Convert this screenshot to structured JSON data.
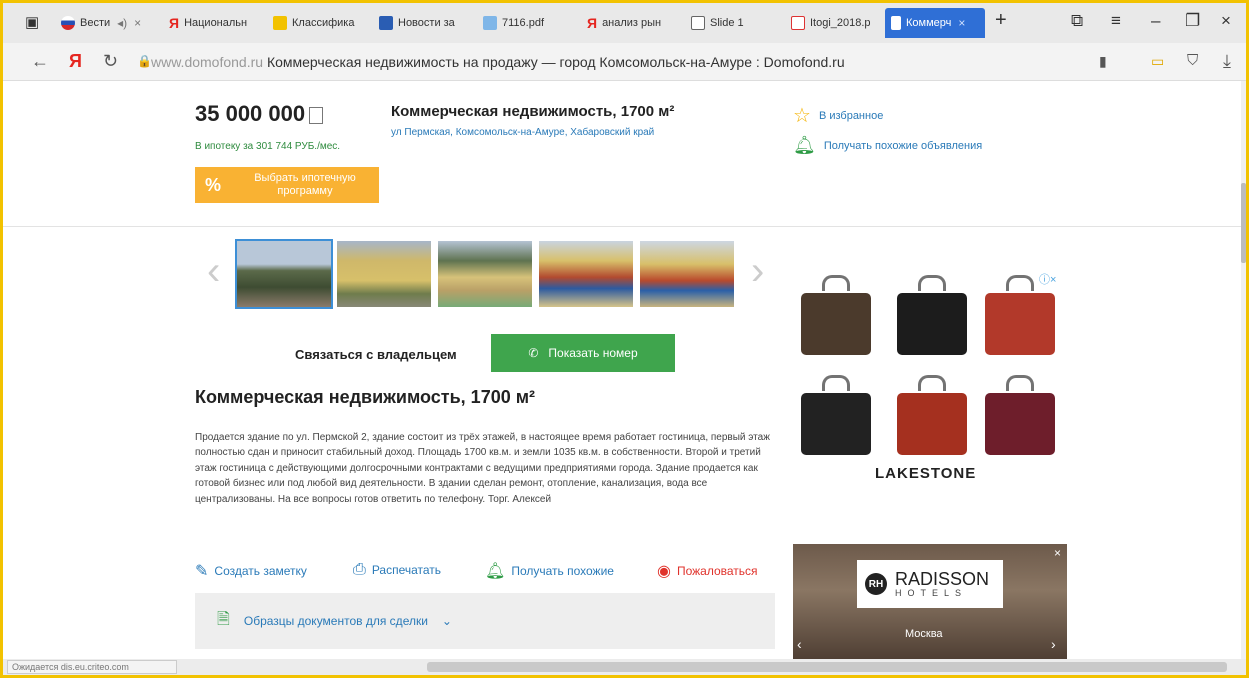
{
  "tabs": [
    {
      "label": "Вести",
      "icon": "vesti-icon"
    },
    {
      "label": "Национальн",
      "icon": "yandex-icon"
    },
    {
      "label": "Классифика",
      "icon": "doc-icon"
    },
    {
      "label": "Новости за",
      "icon": "news-icon"
    },
    {
      "label": "7116.pdf",
      "icon": "pdf-icon"
    },
    {
      "label": "анализ рын",
      "icon": "yandex-icon"
    },
    {
      "label": "Slide 1",
      "icon": "page-icon"
    },
    {
      "label": "Itogi_2018.p",
      "icon": "pdf-icon"
    },
    {
      "label": "Коммерч",
      "icon": "domofond-icon",
      "active": true
    }
  ],
  "address_bar": {
    "domain": "www.domofond.ru",
    "title": "Коммерческая недвижимость на продажу — город Комсомольск-на-Амуре : Domofond.ru",
    "nav_logo": "Я"
  },
  "listing": {
    "price": "35 000 000",
    "mortgage_text": "В ипотеку за 301 744 РУБ./мес.",
    "mortgage_button": "Выбрать ипотечную программу",
    "title": "Коммерческая недвижимость, 1700 м²",
    "address": "ул Пермская, Комсомольск-на-Амуре, Хабаровский край",
    "favorite_label": "В избранное",
    "similar_label": "Получать похожие объявления",
    "contact_label": "Связаться с владельцем",
    "phone_button": "Показать номер",
    "body_title": "Коммерческая недвижимость, 1700 м²",
    "description": "Продается здание по ул. Пермской 2, здание состоит из трёх этажей, в настоящее время работает гостиница, первый этаж полностью сдан и приносит стабильный доход. Площадь 1700 кв.м. и земли 1035 кв.м. в собственности. Второй и третий этаж гостиница с действующими долгосрочными контрактами с ведущими предприятиями города. Здание продается как готовой бизнес или под любой вид деятельности. В здании сделан ремонт, отопление, канализация, вода все централизованы. На все вопросы готов ответить по телефону. Торг. Алексей",
    "actions": {
      "note": "Создать заметку",
      "print": "Распечатать",
      "similar": "Получать похожие",
      "complain": "Пожаловаться"
    },
    "docs_label": "Образцы документов для сделки"
  },
  "ads": {
    "bags_brand": "LAKESTONE",
    "hotel_brand": "RADISSON",
    "hotel_sub": "HOTELS",
    "hotel_city": "Москва"
  },
  "status_bar": "Ожидается dis.eu.criteo.com",
  "colors": {
    "accent_blue": "#2f6fd6",
    "link": "#2a7ab8",
    "green": "#3fa54d",
    "orange": "#f9b233",
    "red": "#e0322b"
  }
}
